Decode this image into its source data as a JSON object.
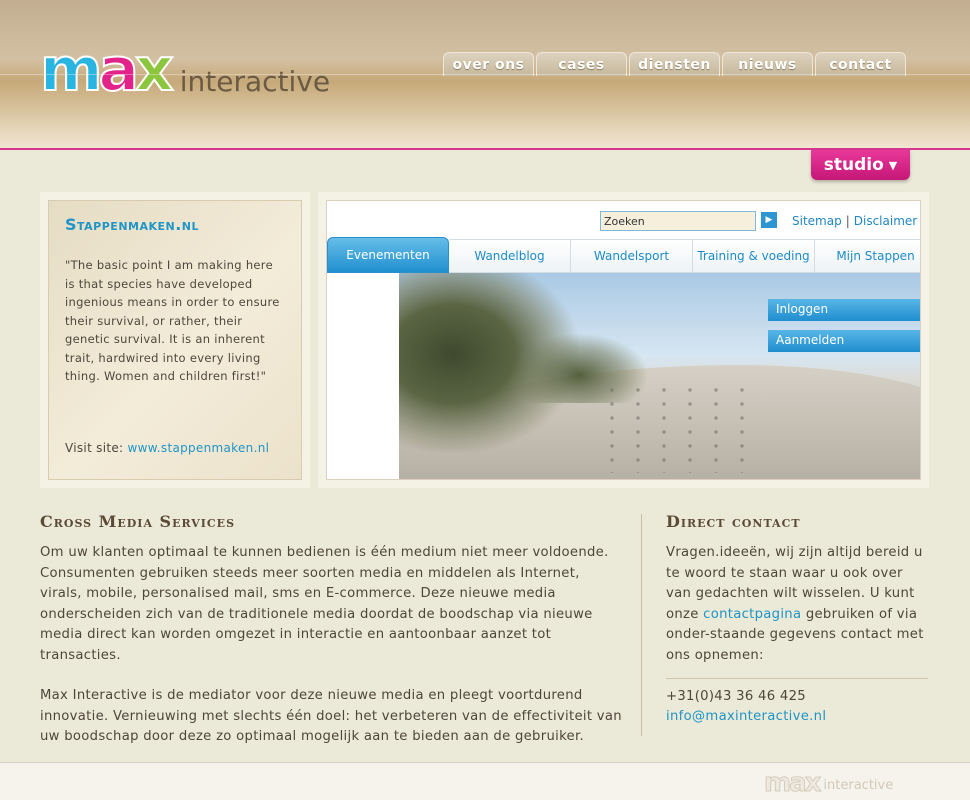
{
  "brand": {
    "logo_max": [
      "m",
      "a",
      "x"
    ],
    "logo_sub": "interactive",
    "colors": {
      "m": "#28b5e2",
      "a": "#e2238a",
      "x": "#8cc63e",
      "accent": "#d6388e",
      "link": "#1f95c8"
    }
  },
  "nav": {
    "items": [
      {
        "label": "over ons"
      },
      {
        "label": "cases"
      },
      {
        "label": "diensten"
      },
      {
        "label": "nieuws"
      },
      {
        "label": "contact"
      }
    ],
    "studio_label": "studio",
    "studio_icon": "caret-down-icon"
  },
  "showcase": {
    "title": "Stappenmaken.nl",
    "quote": "\"The basic point I am making here is that species have developed ingenious means in order to ensure their survival, or rather, their genetic survival. It is an inherent trait, hardwired into every living thing. Women and children first!\"",
    "visit_label": "Visit site:",
    "visit_link": "www.stappenmaken.nl"
  },
  "screenshot": {
    "search_value": "Zoeken",
    "go_icon": "arrow-right-icon",
    "sitemap": "Sitemap",
    "separator": "|",
    "disclaimer": "Disclaimer",
    "tabs": [
      {
        "label": "Evenementen"
      },
      {
        "label": "Wandelblog"
      },
      {
        "label": "Wandelsport"
      },
      {
        "label": "Training & voeding"
      },
      {
        "label": "Mijn Stappen"
      }
    ],
    "login": "Inloggen",
    "register": "Aanmelden"
  },
  "cms": {
    "title": "Cross Media Services",
    "p1": "Om uw klanten optimaal te kunnen bedienen is één medium niet meer voldoende. Consumenten gebruiken steeds meer soorten media en middelen als Internet, virals, mobile, personalised mail, sms en E-commerce. Deze nieuwe media onderscheiden zich van de traditionele media doordat de boodschap via nieuwe media direct kan worden omgezet in interactie en aantoonbaar aanzet tot transacties.",
    "p2": "Max Interactive is de mediator voor deze nieuwe media en pleegt voortdurend innovatie. Vernieuwing met slechts één doel: het verbeteren van de effectiviteit van uw boodschap door deze zo optimaal mogelijk aan te bieden aan de gebruiker."
  },
  "contact": {
    "title": "Direct contact",
    "text_before": "Vragen.ideeën, wij zijn altijd bereid u te woord te staan waar u ook over van gedachten wilt wisselen. U kunt onze ",
    "link_label": "contactpagina",
    "text_after": " gebruiken of via onder-staande gegevens contact met ons opnemen:",
    "phone": "+31(0)43 36 46 425",
    "email": "info@maxinteractive.nl"
  },
  "footer": {
    "logo_max": "max",
    "logo_sub": "interactive"
  }
}
